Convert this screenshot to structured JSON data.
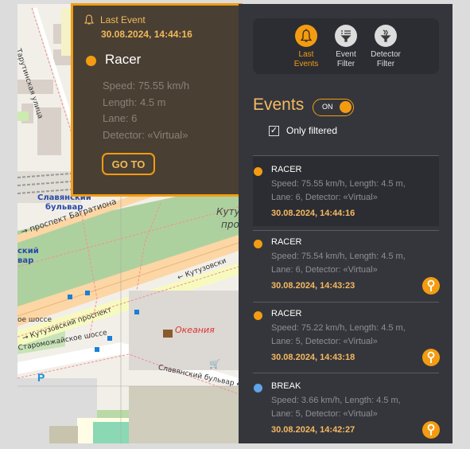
{
  "map": {
    "labels": {
      "street_tarutinskaya": "Тарутинская улица",
      "slavyansky_1": "Славянский",
      "slavyansky_2": "бульвар",
      "bagrationa": "→ проспект Багратиона",
      "kutuz_park_1": "Куту",
      "kutuz_park_2": "про",
      "left_blue_1": "ский",
      "left_blue_2": "вар",
      "kutuzovsky_right": "← Кутузовски",
      "shosse_left": "ое шоссе",
      "kutuzovsky_prospekt": "→ Кутузовский проспект",
      "staromozhayskoe": "Староможайское шоссе",
      "okeania": "Океания",
      "slavyansky_bulvar": "Славянский бульвар ←",
      "parking": "P"
    }
  },
  "popup": {
    "header_title": "Last Event",
    "header_date": "30.08.2024, 14:44:16",
    "event_name": "Racer",
    "event_color": "#f39c12",
    "details": [
      "Speed: 75.55 km/h",
      "Length: 4.5 m",
      "Lane: 6",
      "Detector: «Virtual»"
    ],
    "goto_label": "GO TO"
  },
  "panel": {
    "toolbar": [
      {
        "line1": "Last",
        "line2": "Events",
        "icon": "bell-icon",
        "active": true
      },
      {
        "line1": "Event",
        "line2": "Filter",
        "icon": "event-filter-icon",
        "active": false
      },
      {
        "line1": "Detector",
        "line2": "Filter",
        "icon": "detector-filter-icon",
        "active": false
      }
    ],
    "events_title": "Events",
    "toggle_label": "ON",
    "toggle_on": true,
    "only_filtered_label": "Only filtered",
    "only_filtered_checked": true,
    "events": [
      {
        "type": "RACER",
        "color": "#f39c12",
        "desc1": "Speed: 75.55 km/h, Length: 4.5 m,",
        "desc2": "Lane: 6, Detector: «Virtual»",
        "date": "30.08.2024, 14:44:16",
        "selected": true
      },
      {
        "type": "RACER",
        "color": "#f39c12",
        "desc1": "Speed: 75.54 km/h, Length: 4.5 m,",
        "desc2": "Lane: 6, Detector: «Virtual»",
        "date": "30.08.2024, 14:43:23",
        "selected": false
      },
      {
        "type": "RACER",
        "color": "#f39c12",
        "desc1": "Speed: 75.22 km/h, Length: 4.5 m,",
        "desc2": "Lane: 5, Detector: «Virtual»",
        "date": "30.08.2024, 14:43:18",
        "selected": false
      },
      {
        "type": "BREAK",
        "color": "#5fa3ea",
        "desc1": "Speed: 3.66 km/h, Length: 4.5 m,",
        "desc2": "Lane: 5, Detector: «Virtual»",
        "date": "30.08.2024, 14:42:27",
        "selected": false
      }
    ]
  }
}
